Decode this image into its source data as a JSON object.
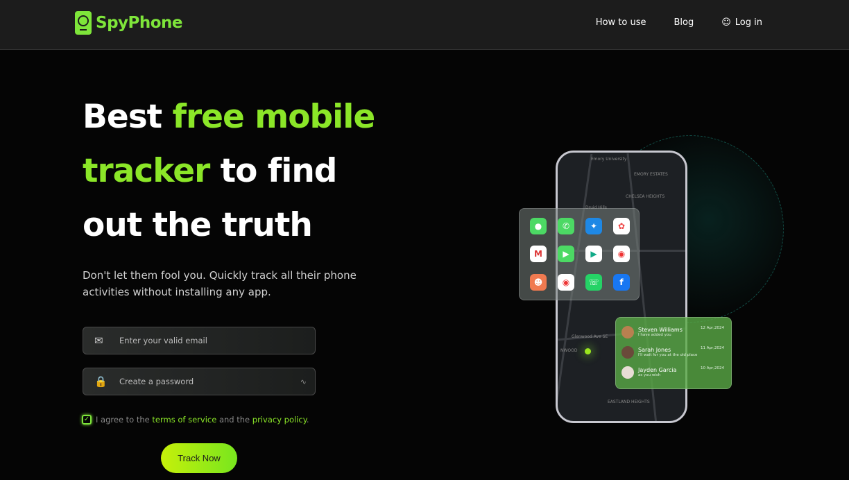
{
  "header": {
    "brand": "SpyPhone",
    "nav": [
      {
        "label": "How to use"
      },
      {
        "label": "Blog"
      },
      {
        "label": "Log in",
        "icon": "user-icon"
      }
    ]
  },
  "hero": {
    "title_1": "Best ",
    "title_2": "free mobile",
    "title_3": "tracker",
    "title_4": " to find",
    "title_5": "out the truth",
    "subtitle": "Don't let them fool you. Quickly track all their phone activities without installing any app."
  },
  "form": {
    "email_placeholder": "Enter your valid email",
    "password_placeholder": "Create a password",
    "agree_1": "I agree to the ",
    "terms": "terms of service",
    "agree_2": " and the ",
    "privacy": "privacy policy",
    "agree_3": ".",
    "checked": true,
    "submit": "Track Now"
  },
  "map": {
    "labels": [
      "Emory University",
      "EMORY ESTATES",
      "CHELSEA HEIGHTS",
      "Druid Hills",
      "Glenwood Ave SE",
      "NWOOD",
      "EASTLAND HEIGHTS"
    ]
  },
  "apps": [
    {
      "icon": "messages-icon",
      "color": "#4cd964"
    },
    {
      "icon": "phone-icon",
      "color": "#4cd964"
    },
    {
      "icon": "safari-icon",
      "color": "#1e88e5"
    },
    {
      "icon": "photos-icon",
      "color": "#ffffff"
    },
    {
      "icon": "gmail-icon",
      "color": "#ffffff"
    },
    {
      "icon": "facetime-icon",
      "color": "#4cd964"
    },
    {
      "icon": "play-store-icon",
      "color": "#ffffff"
    },
    {
      "icon": "chrome-icon",
      "color": "#ffffff"
    },
    {
      "icon": "contacts-icon",
      "color": "#f07a50"
    },
    {
      "icon": "maps-icon",
      "color": "#ffffff"
    },
    {
      "icon": "whatsapp-icon",
      "color": "#25d366"
    },
    {
      "icon": "facebook-icon",
      "color": "#1877f2"
    }
  ],
  "messages": [
    {
      "name": "Steven Williams",
      "text": "I have added you",
      "date": "12 Apr,2024"
    },
    {
      "name": "Sarah Jones",
      "text": "I'll wait for you at the old place",
      "date": "11 Apr,2024"
    },
    {
      "name": "Jayden Garcia",
      "text": "as you wish",
      "date": "10 Apr,2024"
    }
  ],
  "colors": {
    "accent": "#8be628",
    "background": "#050505",
    "header": "#1c1c1c"
  }
}
